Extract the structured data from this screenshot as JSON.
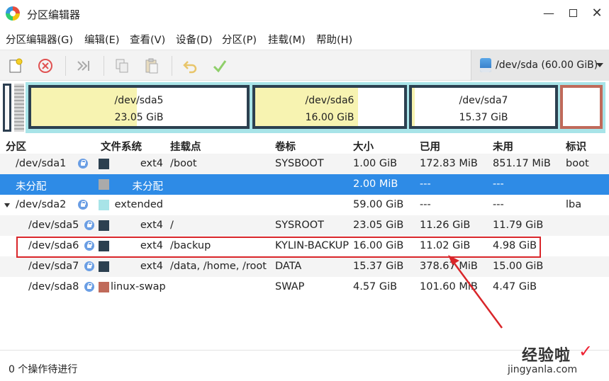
{
  "window": {
    "title": "分区编辑器"
  },
  "menu": [
    "分区编辑器(G)",
    "编辑(E)",
    "查看(V)",
    "设备(D)",
    "分区(P)",
    "挂载(M)",
    "帮助(H)"
  ],
  "toolbar": {
    "device": "/dev/sda (60.00 GiB)"
  },
  "diskmap": {
    "partitions": [
      {
        "name": "/dev/sda5",
        "size": "23.05 GiB",
        "used_fraction": 0.49
      },
      {
        "name": "/dev/sda6",
        "size": "16.00 GiB",
        "used_fraction": 0.69
      },
      {
        "name": "/dev/sda7",
        "size": "15.37 GiB",
        "used_fraction": 0.02
      }
    ]
  },
  "table": {
    "headers": {
      "partition": "分区",
      "fs": "文件系统",
      "mount": "挂载点",
      "label": "卷标",
      "size": "大小",
      "used": "已用",
      "unused": "未用",
      "flags": "标识"
    },
    "rows": [
      {
        "partition": "/dev/sda1",
        "fs": "ext4",
        "mount": "/boot",
        "label": "SYSBOOT",
        "size": "1.00 GiB",
        "used": "172.83 MiB",
        "unused": "851.17 MiB",
        "flags": "boot",
        "color": "#2c4050"
      },
      {
        "partition": "未分配",
        "fs": "未分配",
        "mount": "",
        "label": "",
        "size": "2.00 MiB",
        "used": "---",
        "unused": "---",
        "flags": "",
        "color": "#aaaaaa"
      },
      {
        "partition": "/dev/sda2",
        "fs": "extended",
        "mount": "",
        "label": "",
        "size": "59.00 GiB",
        "used": "---",
        "unused": "---",
        "flags": "lba",
        "color": "#a8e4e8"
      },
      {
        "partition": "/dev/sda5",
        "fs": "ext4",
        "mount": "/",
        "label": "SYSROOT",
        "size": "23.05 GiB",
        "used": "11.26 GiB",
        "unused": "11.79 GiB",
        "flags": "",
        "color": "#2c4050"
      },
      {
        "partition": "/dev/sda6",
        "fs": "ext4",
        "mount": "/backup",
        "label": "KYLIN-BACKUP",
        "size": "16.00 GiB",
        "used": "11.02 GiB",
        "unused": "4.98 GiB",
        "flags": "",
        "color": "#2c4050"
      },
      {
        "partition": "/dev/sda7",
        "fs": "ext4",
        "mount": "/data, /home, /root",
        "label": "DATA",
        "size": "15.37 GiB",
        "used": "378.67 MiB",
        "unused": "15.00 GiB",
        "flags": "",
        "color": "#2c4050"
      },
      {
        "partition": "/dev/sda8",
        "fs": "linux-swap",
        "mount": "",
        "label": "SWAP",
        "size": "4.57 GiB",
        "used": "101.60 MiB",
        "unused": "4.47 GiB",
        "flags": "",
        "color": "#c06a5a"
      }
    ]
  },
  "status": "0 个操作待进行",
  "watermark": {
    "main": "经验啦",
    "url": "jingyanla.com"
  }
}
